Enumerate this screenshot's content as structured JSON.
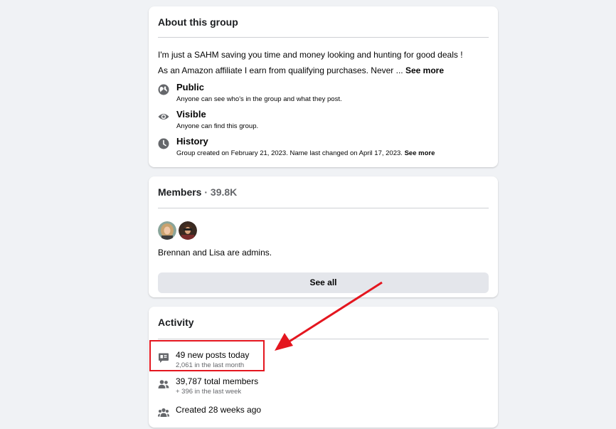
{
  "about": {
    "title": "About this group",
    "desc_line1": "I'm just a SAHM saving you time and money looking and hunting for good deals !",
    "desc_line2": "As an Amazon affiliate I earn from qualifying purchases. Never ...",
    "see_more": "See more",
    "items": [
      {
        "icon": "globe-icon",
        "title": "Public",
        "subtitle": "Anyone can see who's in the group and what they post."
      },
      {
        "icon": "eye-icon",
        "title": "Visible",
        "subtitle": "Anyone can find this group."
      },
      {
        "icon": "clock-icon",
        "title": "History",
        "subtitle": "Group created on February 21, 2023. Name last changed on April 17, 2023.",
        "see_more": "See more"
      }
    ]
  },
  "members": {
    "title": "Members",
    "separator": " · ",
    "count": "39.8K",
    "admins_text": "Brennan and Lisa are admins.",
    "see_all": "See all"
  },
  "activity": {
    "title": "Activity",
    "items": [
      {
        "icon": "new-posts-icon",
        "main": "49 new posts today",
        "sub": "2,061 in the last month"
      },
      {
        "icon": "members-icon",
        "main": "39,787 total members",
        "sub": "+ 396 in the last week"
      },
      {
        "icon": "group-created-icon",
        "main": "Created 28 weeks ago",
        "sub": ""
      }
    ]
  },
  "colors": {
    "background": "#f0f2f5",
    "annotation": "#e4161f",
    "icon_gray": "#8a8d91"
  }
}
